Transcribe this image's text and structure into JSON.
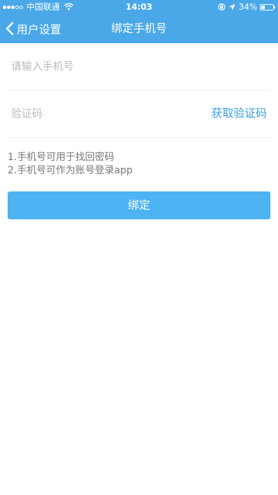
{
  "status_bar": {
    "carrier": "中国联通",
    "time": "14:03",
    "battery_percent": "34%",
    "battery_level": 0.34,
    "signal_bars_filled": 3,
    "signal_bars_total": 5
  },
  "nav_bar": {
    "back_label": "用户设置",
    "title": "绑定手机号"
  },
  "form": {
    "phone_placeholder": "请输入手机号",
    "phone_value": "",
    "code_placeholder": "验证码",
    "code_value": "",
    "get_code_label": "获取验证码"
  },
  "notes": [
    "1.手机号可用于找回密码",
    "2.手机号可作为账号登录app"
  ],
  "bind_button_label": "绑定",
  "colors": {
    "header_bg": "#4aa8e8",
    "link": "#3b9ee0",
    "button_bg": "#4db3f2"
  },
  "icons": {
    "back": "chevron-left-icon",
    "wifi": "wifi-icon",
    "orientation_lock": "orientation-lock-icon",
    "location": "location-arrow-icon",
    "battery": "battery-icon"
  }
}
